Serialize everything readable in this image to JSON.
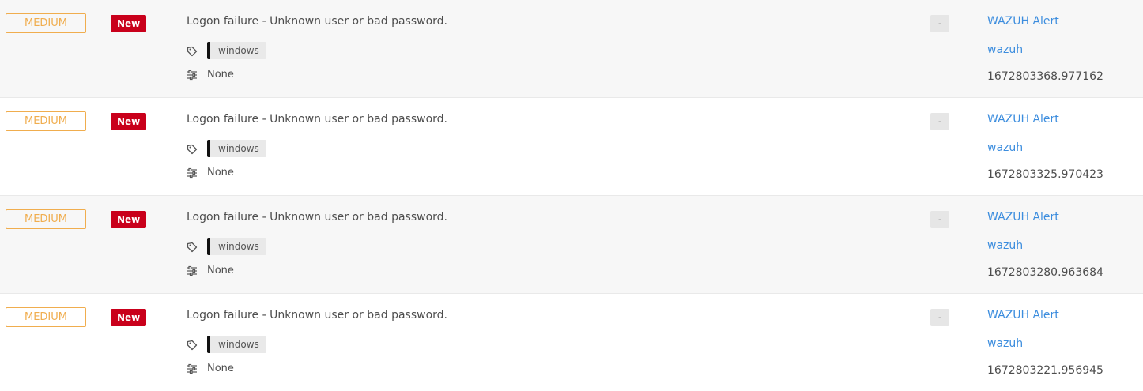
{
  "colors": {
    "severity_medium": "#f0ad4e",
    "status_new": "#c9001b",
    "link": "#3c8dde",
    "tag_bg": "#e9e9e9",
    "row_shade": "#f7f7f7"
  },
  "icons": {
    "tag": "tag-icon",
    "custom_fields": "sliders-icon"
  },
  "alerts": [
    {
      "severity": "MEDIUM",
      "status": "New",
      "title": "Logon failure - Unknown user or bad password.",
      "tags": [
        "windows"
      ],
      "custom_fields": "None",
      "observables": "-",
      "source": "WAZUH Alert",
      "type": "wazuh",
      "reference": "1672803368.977162"
    },
    {
      "severity": "MEDIUM",
      "status": "New",
      "title": "Logon failure - Unknown user or bad password.",
      "tags": [
        "windows"
      ],
      "custom_fields": "None",
      "observables": "-",
      "source": "WAZUH Alert",
      "type": "wazuh",
      "reference": "1672803325.970423"
    },
    {
      "severity": "MEDIUM",
      "status": "New",
      "title": "Logon failure - Unknown user or bad password.",
      "tags": [
        "windows"
      ],
      "custom_fields": "None",
      "observables": "-",
      "source": "WAZUH Alert",
      "type": "wazuh",
      "reference": "1672803280.963684"
    },
    {
      "severity": "MEDIUM",
      "status": "New",
      "title": "Logon failure - Unknown user or bad password.",
      "tags": [
        "windows"
      ],
      "custom_fields": "None",
      "observables": "-",
      "source": "WAZUH Alert",
      "type": "wazuh",
      "reference": "1672803221.956945"
    }
  ]
}
